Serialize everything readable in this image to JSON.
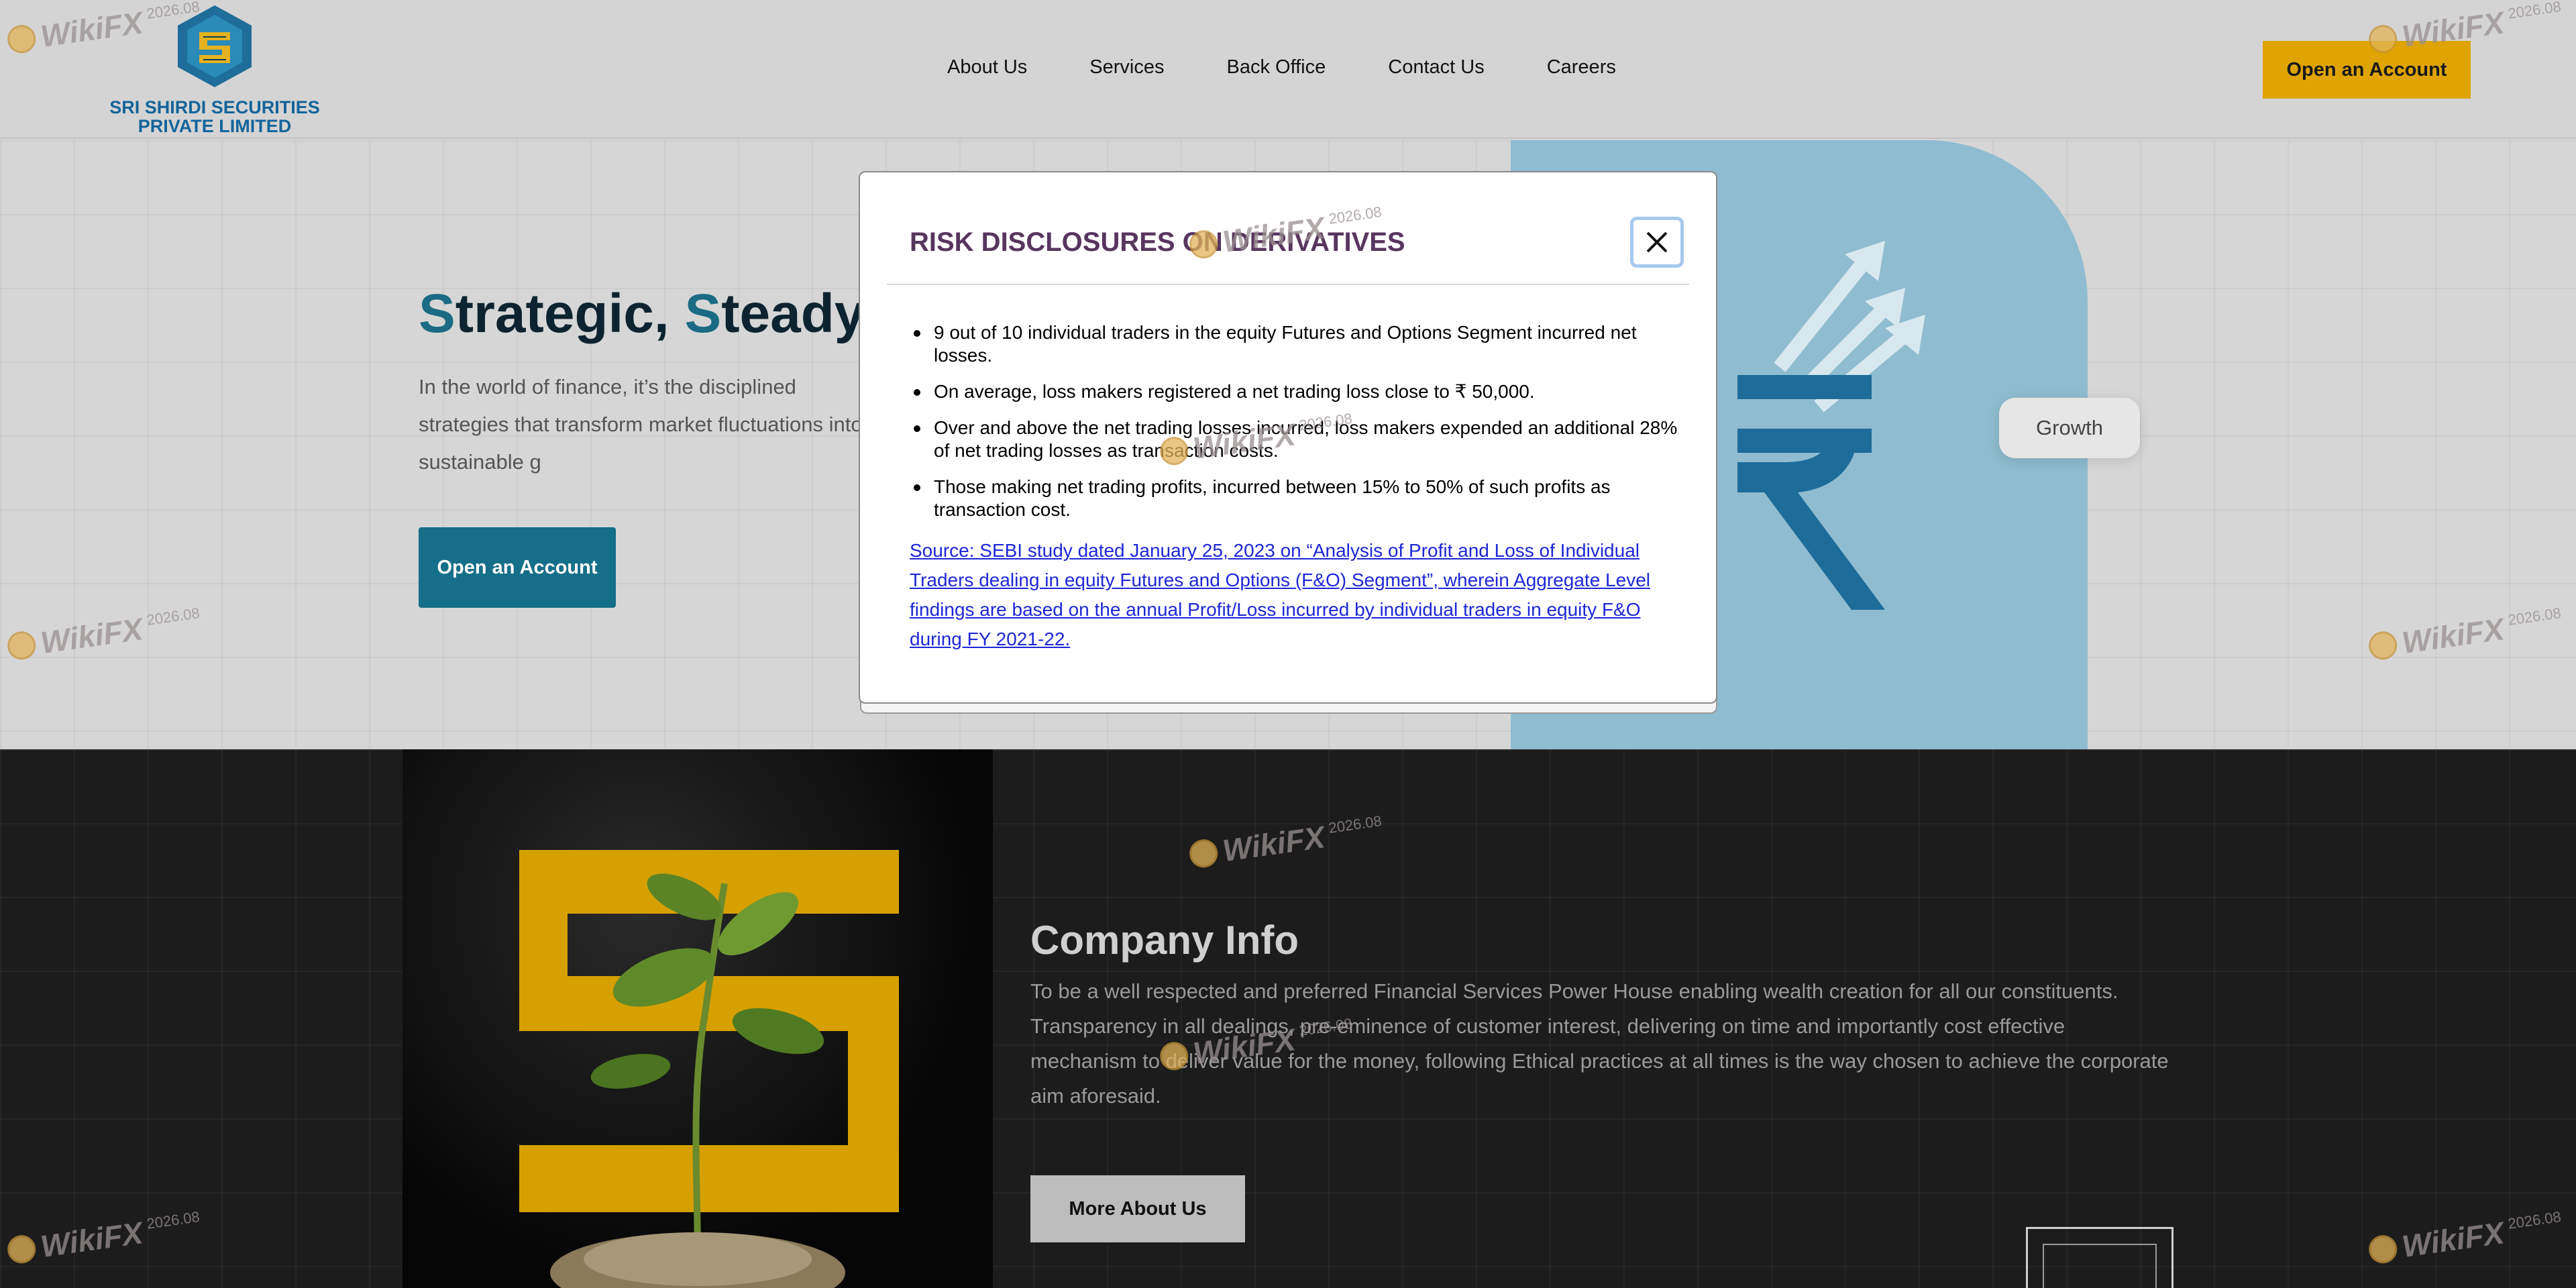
{
  "header": {
    "logo_line1": "SRI SHIRDI SECURITIES",
    "logo_line2": "PRIVATE LIMITED",
    "nav": [
      "About Us",
      "Services",
      "Back Office",
      "Contact Us",
      "Careers"
    ],
    "cta": "Open an Account"
  },
  "hero": {
    "title_s1": "S",
    "title_w1": "trategic, ",
    "title_s2": "S",
    "title_w2": "teady,",
    "text": "In the world of finance, it’s the disciplined strategies that transform market fluctuations into sustainable g",
    "cta": "Open an Account",
    "growth_label": "Growth"
  },
  "company": {
    "title": "Company Info",
    "text": "To be a well respected and preferred Financial Services Power House enabling wealth creation for all our constituents. Transparency in all dealings, pre-eminence of customer interest, delivering on time and importantly cost effective mechanism to deliver value for the money, following Ethical practices at all times is the way chosen to achieve the corporate aim aforesaid.",
    "cta": "More About Us"
  },
  "modal": {
    "title": "RISK DISCLOSURES ON DERIVATIVES",
    "close_icon": "close-icon",
    "items": [
      "9 out of 10 individual traders in the equity Futures and Options Segment incurred net losses.",
      "On average, loss makers registered a net trading loss close to ₹ 50,000.",
      "Over and above the net trading losses incurred, loss makers expended an additional 28% of net trading losses as transaction costs.",
      "Those making net trading profits, incurred between 15% to 50% of such profits as transaction cost."
    ],
    "source": "Source: SEBI study dated January 25, 2023 on “Analysis of Profit and Loss of Individual Traders dealing in equity Futures and Options (F&O) Segment”, wherein Aggregate Level findings are based on the annual Profit/Loss incurred by individual traders in equity F&O during FY 2021-22."
  },
  "watermark": {
    "text": "WikiFX",
    "year": "2026.08"
  },
  "colors": {
    "brand_teal": "#156f88",
    "accent_gold": "#e0a400",
    "modal_title": "#57365e",
    "link_blue": "#1c27d6"
  }
}
